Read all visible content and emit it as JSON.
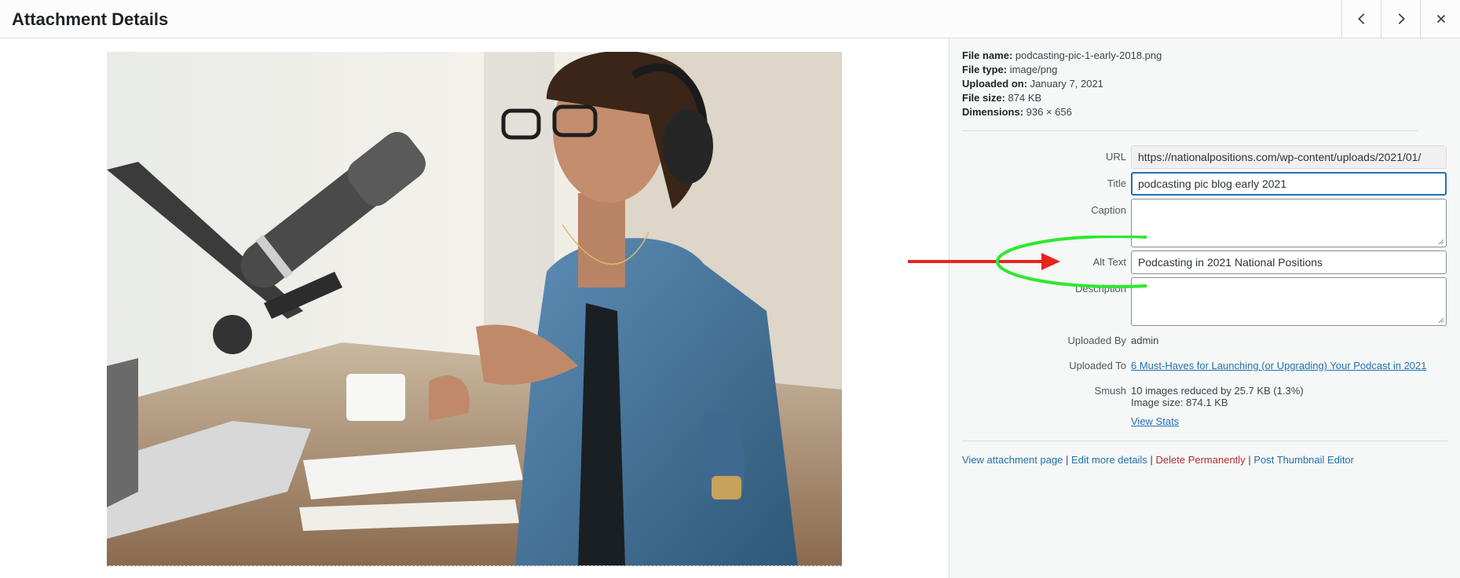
{
  "header": {
    "title": "Attachment Details",
    "prev_icon": "chevron-left-icon",
    "next_icon": "chevron-right-icon",
    "close_icon": "close-icon"
  },
  "file_info": {
    "name_label": "File name:",
    "name_value": "podcasting-pic-1-early-2018.png",
    "type_label": "File type:",
    "type_value": "image/png",
    "uploaded_label": "Uploaded on:",
    "uploaded_value": "January 7, 2021",
    "size_label": "File size:",
    "size_value": "874 KB",
    "dims_label": "Dimensions:",
    "dims_value": "936 × 656"
  },
  "fields": {
    "url_label": "URL",
    "url_value": "https://nationalpositions.com/wp-content/uploads/2021/01/",
    "title_label": "Title",
    "title_value": "podcasting pic blog early 2021",
    "caption_label": "Caption",
    "caption_value": "",
    "alt_label": "Alt Text",
    "alt_value": "Podcasting in 2021 National Positions",
    "description_label": "Description",
    "description_value": "",
    "uploaded_by_label": "Uploaded By",
    "uploaded_by_value": "admin",
    "uploaded_to_label": "Uploaded To",
    "uploaded_to_value": "6 Must-Haves for Launching (or Upgrading) Your Podcast in 2021",
    "smush_label": "Smush",
    "smush_line1": "10 images reduced by 25.7 KB (1.3%)",
    "smush_line2": "Image size: 874.1 KB",
    "smush_link": "View Stats"
  },
  "actions": {
    "view_page": "View attachment page",
    "edit_details": "Edit more details",
    "delete": "Delete Permanently",
    "thumbnail_editor": "Post Thumbnail Editor",
    "separator": "|"
  },
  "colors": {
    "link": "#2271b1",
    "delete": "#b32d2e",
    "annotation_arrow": "#e8231e",
    "annotation_circle": "#2ee82e"
  }
}
